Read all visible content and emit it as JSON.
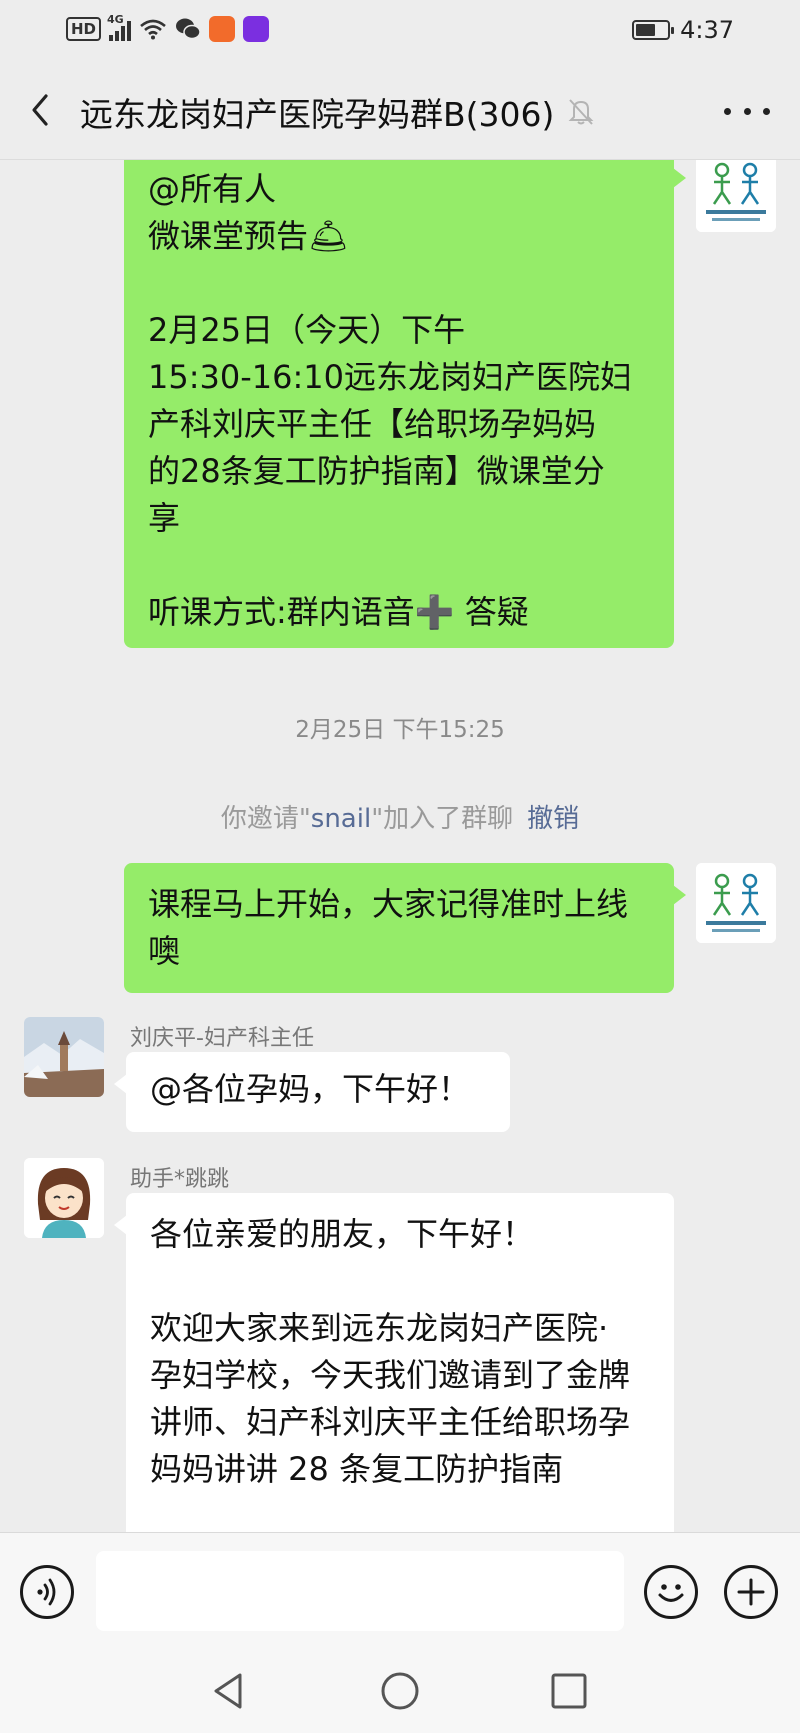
{
  "status_bar": {
    "hd": "HD",
    "network": "4G",
    "time": "4:37",
    "battery_level": 0.6
  },
  "header": {
    "title": "远东龙岗妇产医院孕妈群B(306)"
  },
  "messages": {
    "m1": "@所有人\n微课堂预告🛎\n\n2月25日（今天）下午\n15:30-16:10远东龙岗妇产医院妇\n产科刘庆平主任【给职场孕妈妈\n的28条复工防护指南】微课堂分\n享\n\n听课方式:群内语音➕ 答疑",
    "time_separator": "2月25日 下午15:25",
    "sys_prefix": "你邀请\"",
    "sys_name": "snail",
    "sys_suffix": "\"加入了群聊",
    "sys_undo": "撤销",
    "m2": "课程马上开始，大家记得准时上线\n噢",
    "m3_sender": "刘庆平-妇产科主任",
    "m3": "@各位孕妈，下午好！",
    "m4_sender": "助手*跳跳",
    "m4": "各位亲爱的朋友，下午好！\n\n欢迎大家来到远东龙岗妇产医院·\n孕妇学校，今天我们邀请到了金牌\n讲师、妇产科刘庆平主任给职场孕\n妈妈讲讲 28 条复工防护指南"
  },
  "colors": {
    "sent_bubble": "#95ec69",
    "received_bubble": "#ffffff",
    "background": "#ededed",
    "link": "#576b95"
  },
  "icons": {
    "back": "chevron-left-icon",
    "mute": "bell-off-icon",
    "more": "more-dots-icon",
    "voice": "voice-icon",
    "emoji": "emoji-icon",
    "plus": "plus-icon"
  }
}
